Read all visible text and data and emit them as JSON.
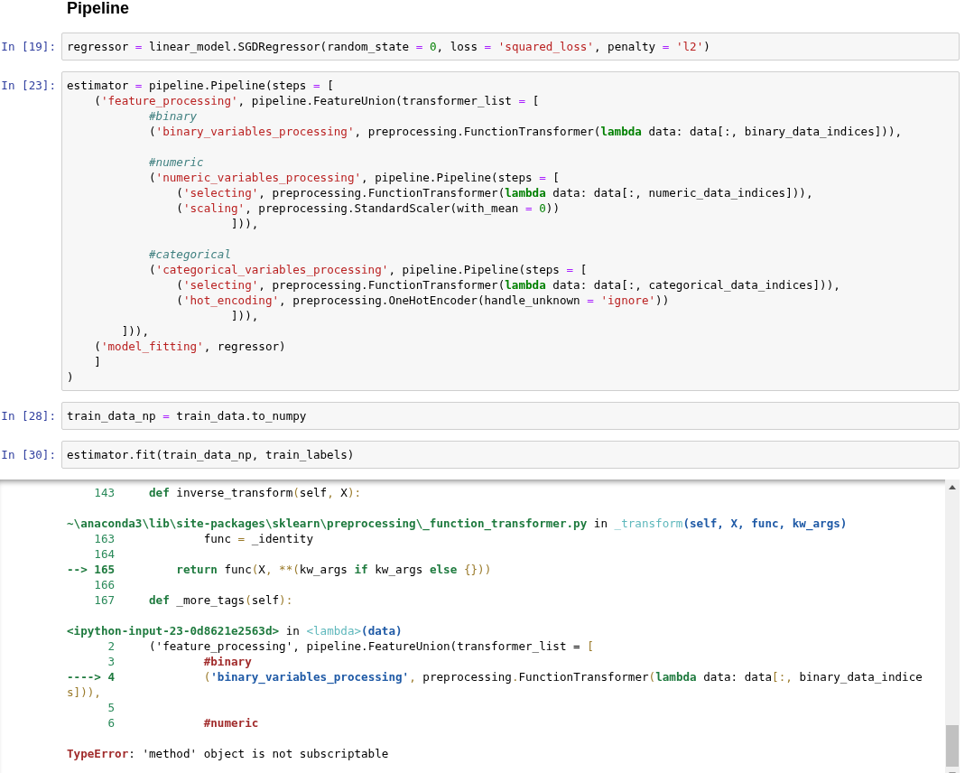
{
  "heading": "Pipeline",
  "cells": [
    {
      "prompt": "In [19]:",
      "lines": [
        {
          "tokens": [
            {
              "text": "regressor ",
              "kind": "plain"
            },
            {
              "text": "=",
              "kind": "op"
            },
            {
              "text": " linear_model.SGDRegressor(random_state ",
              "kind": "plain"
            },
            {
              "text": "=",
              "kind": "op"
            },
            {
              "text": " 0",
              "kind": "num"
            },
            {
              "text": ", loss ",
              "kind": "plain"
            },
            {
              "text": "=",
              "kind": "op"
            },
            {
              "text": " 'squared_loss'",
              "kind": "str"
            },
            {
              "text": ", penalty ",
              "kind": "plain"
            },
            {
              "text": "=",
              "kind": "op"
            },
            {
              "text": " 'l2'",
              "kind": "str"
            },
            {
              "text": ")",
              "kind": "plain"
            }
          ]
        }
      ]
    },
    {
      "prompt": "In [23]:",
      "lines": [
        {
          "tokens": [
            {
              "text": "estimator ",
              "kind": "plain"
            },
            {
              "text": "=",
              "kind": "op"
            },
            {
              "text": " pipeline.Pipeline(steps ",
              "kind": "plain"
            },
            {
              "text": "=",
              "kind": "op"
            },
            {
              "text": " [",
              "kind": "plain"
            }
          ]
        },
        {
          "tokens": [
            {
              "text": "    (",
              "kind": "plain"
            },
            {
              "text": "'feature_processing'",
              "kind": "str"
            },
            {
              "text": ", pipeline.FeatureUnion(transformer_list ",
              "kind": "plain"
            },
            {
              "text": "=",
              "kind": "op"
            },
            {
              "text": " [",
              "kind": "plain"
            }
          ]
        },
        {
          "tokens": [
            {
              "text": "            #binary",
              "kind": "comment"
            }
          ]
        },
        {
          "tokens": [
            {
              "text": "            (",
              "kind": "plain"
            },
            {
              "text": "'binary_variables_processing'",
              "kind": "str"
            },
            {
              "text": ", preprocessing.FunctionTransformer(",
              "kind": "plain"
            },
            {
              "text": "lambda",
              "kind": "kw"
            },
            {
              "text": " data: data[:, binary_data_indices])),",
              "kind": "plain"
            }
          ]
        },
        {
          "blank_before": true,
          "tokens": [
            {
              "text": "            #numeric",
              "kind": "comment"
            }
          ]
        },
        {
          "tokens": [
            {
              "text": "            (",
              "kind": "plain"
            },
            {
              "text": "'numeric_variables_processing'",
              "kind": "str"
            },
            {
              "text": ", pipeline.Pipeline(steps ",
              "kind": "plain"
            },
            {
              "text": "=",
              "kind": "op"
            },
            {
              "text": " [",
              "kind": "plain"
            }
          ]
        },
        {
          "tokens": [
            {
              "text": "                (",
              "kind": "plain"
            },
            {
              "text": "'selecting'",
              "kind": "str"
            },
            {
              "text": ", preprocessing.FunctionTransformer(",
              "kind": "plain"
            },
            {
              "text": "lambda",
              "kind": "kw"
            },
            {
              "text": " data: data[:, numeric_data_indices])),",
              "kind": "plain"
            }
          ]
        },
        {
          "tokens": [
            {
              "text": "                (",
              "kind": "plain"
            },
            {
              "text": "'scaling'",
              "kind": "str"
            },
            {
              "text": ", preprocessing.StandardScaler(with_mean ",
              "kind": "plain"
            },
            {
              "text": "=",
              "kind": "op"
            },
            {
              "text": " 0",
              "kind": "num"
            },
            {
              "text": "))",
              "kind": "plain"
            }
          ]
        },
        {
          "tokens": [
            {
              "text": "                        ])),",
              "kind": "plain"
            }
          ]
        },
        {
          "blank_before": true,
          "tokens": [
            {
              "text": "            #categorical",
              "kind": "comment"
            }
          ]
        },
        {
          "tokens": [
            {
              "text": "            (",
              "kind": "plain"
            },
            {
              "text": "'categorical_variables_processing'",
              "kind": "str"
            },
            {
              "text": ", pipeline.Pipeline(steps ",
              "kind": "plain"
            },
            {
              "text": "=",
              "kind": "op"
            },
            {
              "text": " [",
              "kind": "plain"
            }
          ]
        },
        {
          "tokens": [
            {
              "text": "                (",
              "kind": "plain"
            },
            {
              "text": "'selecting'",
              "kind": "str"
            },
            {
              "text": ", preprocessing.FunctionTransformer(",
              "kind": "plain"
            },
            {
              "text": "lambda",
              "kind": "kw"
            },
            {
              "text": " data: data[:, categorical_data_indices])),",
              "kind": "plain"
            }
          ]
        },
        {
          "tokens": [
            {
              "text": "                (",
              "kind": "plain"
            },
            {
              "text": "'hot_encoding'",
              "kind": "str"
            },
            {
              "text": ", preprocessing.OneHotEncoder(handle_unknown ",
              "kind": "plain"
            },
            {
              "text": "=",
              "kind": "op"
            },
            {
              "text": " 'ignore'",
              "kind": "str"
            },
            {
              "text": "))",
              "kind": "plain"
            }
          ]
        },
        {
          "tokens": [
            {
              "text": "                        ])),",
              "kind": "plain"
            }
          ]
        },
        {
          "tokens": [
            {
              "text": "        ])),",
              "kind": "plain"
            }
          ]
        },
        {
          "tokens": [
            {
              "text": "    (",
              "kind": "plain"
            },
            {
              "text": "'model_fitting'",
              "kind": "str"
            },
            {
              "text": ", regressor)",
              "kind": "plain"
            }
          ]
        },
        {
          "tokens": [
            {
              "text": "    ]",
              "kind": "plain"
            }
          ]
        },
        {
          "tokens": [
            {
              "text": ")",
              "kind": "plain"
            }
          ]
        }
      ]
    },
    {
      "prompt": "In [28]:",
      "lines": [
        {
          "tokens": [
            {
              "text": "train_data_np ",
              "kind": "plain"
            },
            {
              "text": "=",
              "kind": "op"
            },
            {
              "text": " train_data.to_numpy",
              "kind": "plain"
            }
          ]
        }
      ]
    },
    {
      "prompt": "In [30]:",
      "lines": [
        {
          "tokens": [
            {
              "text": "estimator.fit(train_data_np, train_labels)",
              "kind": "plain"
            }
          ]
        }
      ]
    }
  ],
  "traceback": [
    {
      "tokens": [
        {
          "text": "    143     ",
          "kind": "lineno"
        },
        {
          "text": "def",
          "kind": "tb_kw"
        },
        {
          "text": " inverse_transform",
          "kind": "plain"
        },
        {
          "text": "(",
          "kind": "punct"
        },
        {
          "text": "self",
          "kind": "plain"
        },
        {
          "text": ",",
          "kind": "punct"
        },
        {
          "text": " X",
          "kind": "plain"
        },
        {
          "text": "):",
          "kind": "punct"
        }
      ]
    },
    {
      "blank_before": true,
      "tokens": [
        {
          "text": "~\\anaconda3\\lib\\site-packages\\sklearn\\preprocessing\\_function_transformer.py",
          "kind": "file"
        },
        {
          "text": " in ",
          "kind": "plain"
        },
        {
          "text": "_transform",
          "kind": "func"
        },
        {
          "text": "(self, X, func, kw_args)",
          "kind": "args"
        }
      ]
    },
    {
      "tokens": [
        {
          "text": "    163             ",
          "kind": "lineno"
        },
        {
          "text": "func ",
          "kind": "plain"
        },
        {
          "text": "=",
          "kind": "punct"
        },
        {
          "text": " _identity",
          "kind": "plain"
        }
      ]
    },
    {
      "tokens": [
        {
          "text": "    164",
          "kind": "lineno"
        }
      ]
    },
    {
      "tokens": [
        {
          "text": "--> 165         ",
          "kind": "arrow"
        },
        {
          "text": "return",
          "kind": "tb_kw"
        },
        {
          "text": " func",
          "kind": "plain"
        },
        {
          "text": "(",
          "kind": "punct"
        },
        {
          "text": "X",
          "kind": "plain"
        },
        {
          "text": ", **(",
          "kind": "punct"
        },
        {
          "text": "kw_args ",
          "kind": "plain"
        },
        {
          "text": "if",
          "kind": "tb_kw"
        },
        {
          "text": " kw_args ",
          "kind": "plain"
        },
        {
          "text": "else",
          "kind": "tb_kw"
        },
        {
          "text": " {}))",
          "kind": "punct"
        }
      ]
    },
    {
      "tokens": [
        {
          "text": "    166",
          "kind": "lineno"
        }
      ]
    },
    {
      "tokens": [
        {
          "text": "    167     ",
          "kind": "lineno"
        },
        {
          "text": "def",
          "kind": "tb_kw"
        },
        {
          "text": " _more_tags",
          "kind": "plain"
        },
        {
          "text": "(",
          "kind": "punct"
        },
        {
          "text": "self",
          "kind": "plain"
        },
        {
          "text": "):",
          "kind": "punct"
        }
      ]
    },
    {
      "blank_before": true,
      "tokens": [
        {
          "text": "<ipython-input-23-0d8621e2563d>",
          "kind": "file"
        },
        {
          "text": " in ",
          "kind": "plain"
        },
        {
          "text": "<lambda>",
          "kind": "func"
        },
        {
          "text": "(data)",
          "kind": "args"
        }
      ]
    },
    {
      "tokens": [
        {
          "text": "      2     ",
          "kind": "lineno"
        },
        {
          "text": "('feature_processing', pipeline.FeatureUnion(transformer_list = ",
          "kind": "plain"
        },
        {
          "text": "[",
          "kind": "punct"
        }
      ]
    },
    {
      "tokens": [
        {
          "text": "      3             ",
          "kind": "lineno"
        },
        {
          "text": "#binary",
          "kind": "tb_comment"
        }
      ]
    },
    {
      "tokens": [
        {
          "text": "----> 4             ",
          "kind": "arrow"
        },
        {
          "text": "(",
          "kind": "punct"
        },
        {
          "text": "'binary_variables_processing'",
          "kind": "tb_str"
        },
        {
          "text": ",",
          "kind": "punct"
        },
        {
          "text": " preprocessing",
          "kind": "plain"
        },
        {
          "text": ".",
          "kind": "punct"
        },
        {
          "text": "FunctionTransformer",
          "kind": "plain"
        },
        {
          "text": "(",
          "kind": "punct"
        },
        {
          "text": "lambda",
          "kind": "tb_kw"
        },
        {
          "text": " data: data",
          "kind": "plain"
        },
        {
          "text": "[:,",
          "kind": "punct"
        },
        {
          "text": " binary_data_indice",
          "kind": "plain"
        }
      ]
    },
    {
      "tokens": [
        {
          "text": "s])),",
          "kind": "punct"
        }
      ]
    },
    {
      "tokens": [
        {
          "text": "      5",
          "kind": "lineno"
        }
      ]
    },
    {
      "tokens": [
        {
          "text": "      6             ",
          "kind": "lineno"
        },
        {
          "text": "#numeric",
          "kind": "tb_comment"
        }
      ]
    },
    {
      "blank_before": true,
      "tokens": [
        {
          "text": "TypeError",
          "kind": "err_name"
        },
        {
          "text": ": 'method' object is not subscriptable",
          "kind": "plain"
        }
      ]
    }
  ]
}
